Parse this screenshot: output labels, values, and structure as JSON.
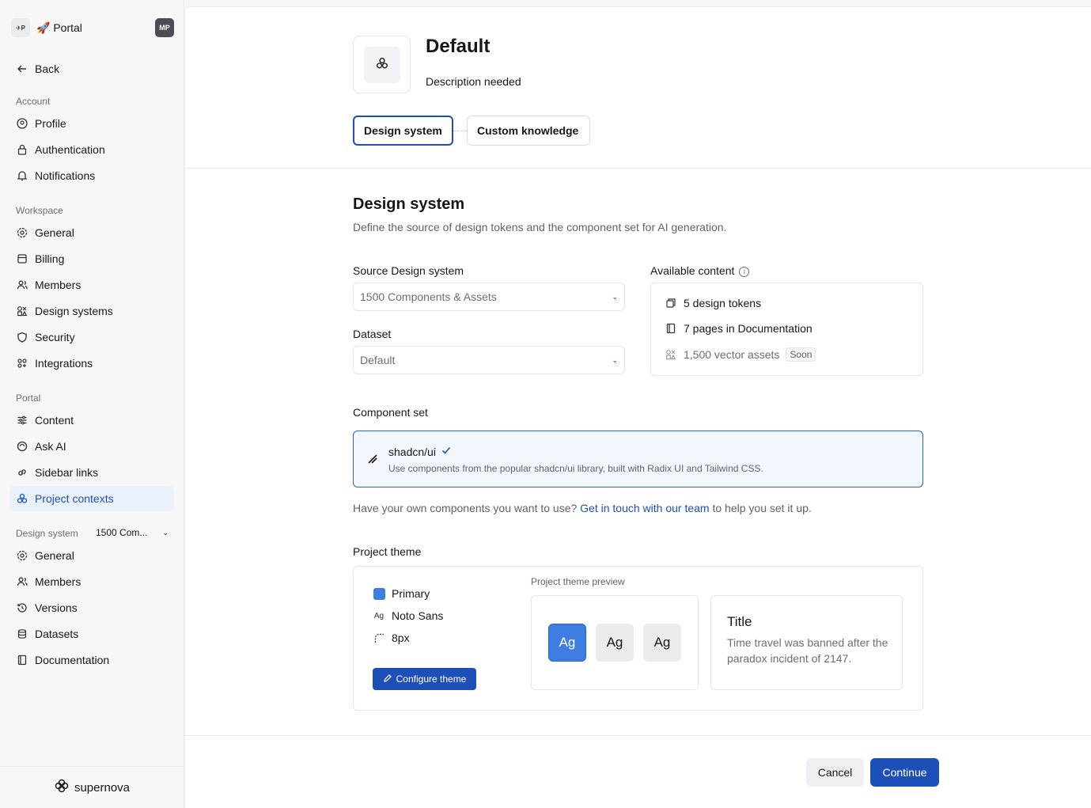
{
  "sidebar": {
    "logo_text": "✈P",
    "portal_name": "🚀 Portal",
    "avatar": "MP",
    "back": "Back",
    "account_label": "Account",
    "account_items": [
      "Profile",
      "Authentication",
      "Notifications"
    ],
    "workspace_label": "Workspace",
    "workspace_items": [
      "General",
      "Billing",
      "Members",
      "Design systems",
      "Security",
      "Integrations"
    ],
    "portal_label": "Portal",
    "portal_items": [
      "Content",
      "Ask AI",
      "Sidebar links",
      "Project contexts"
    ],
    "ds_label": "Design system",
    "ds_value": "1500 Com...",
    "ds_items": [
      "General",
      "Members",
      "Versions",
      "Datasets",
      "Documentation"
    ],
    "footer_brand": "supernova"
  },
  "header": {
    "title": "Default",
    "description": "Description needed",
    "tabs": [
      "Design system",
      "Custom knowledge"
    ]
  },
  "design_system": {
    "title": "Design system",
    "description": "Define the source of design tokens and the component set for AI generation.",
    "source_label": "Source Design system",
    "source_value": "1500 Components & Assets",
    "dataset_label": "Dataset",
    "dataset_value": "Default",
    "available_label": "Available content",
    "available": [
      "5 design tokens",
      "7 pages in Documentation",
      "1,500 vector assets"
    ],
    "soon": "Soon"
  },
  "component_set": {
    "label": "Component set",
    "name": "shadcn/ui",
    "description": "Use components from the popular shadcn/ui library, built with Radix UI and Tailwind CSS.",
    "help_prefix": "Have your own components you want to use?",
    "help_link": "Get in touch with our team",
    "help_suffix": "to help you set it up."
  },
  "theme": {
    "label": "Project theme",
    "primary": "Primary",
    "font_icon": "Ag",
    "font": "Noto Sans",
    "radius": "8px",
    "configure": "Configure theme",
    "preview_label": "Project theme preview",
    "ag": [
      "Ag",
      "Ag",
      "Ag"
    ],
    "preview_title": "Title",
    "preview_body": "Time travel was banned after the paradox incident of 2147.",
    "primary_color": "#3d7ee0"
  },
  "footer": {
    "cancel": "Cancel",
    "continue": "Continue"
  }
}
